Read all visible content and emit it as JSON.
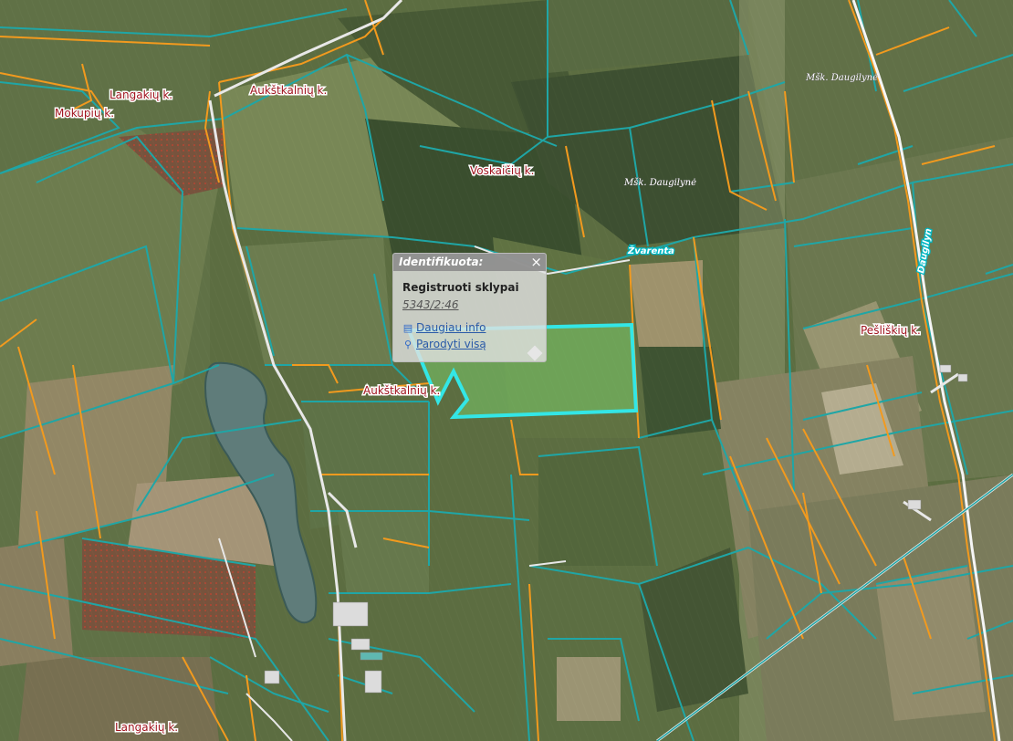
{
  "map": {
    "place_labels": [
      "Langakių k.",
      "Aukštkalnių k.",
      "Mokupių k.",
      "Voskaičių k.",
      "Pešliškių k.",
      "Aukštkalnių k.",
      "Langakių k."
    ],
    "small_labels": [
      "Mšk. Daugilynė",
      "Mšk. Daugilynė"
    ],
    "road_labels": [
      "Žvarenta",
      "Daugilyn"
    ],
    "colors": {
      "parcel_outline": "#1fa6a6",
      "boundary_orange": "#f29a1e",
      "selected_parcel": "#33e6e6",
      "label_red": "#a0141e"
    }
  },
  "popup": {
    "header": "Identifikuota:",
    "close_symbol": "×",
    "layer_title": "Registruoti sklypai",
    "parcel_id": "5343/2:46",
    "more_info_label": "Daugiau info",
    "more_info_icon": "document-icon",
    "show_all_label": "Parodyti visą",
    "show_all_icon": "magnifier-icon"
  }
}
